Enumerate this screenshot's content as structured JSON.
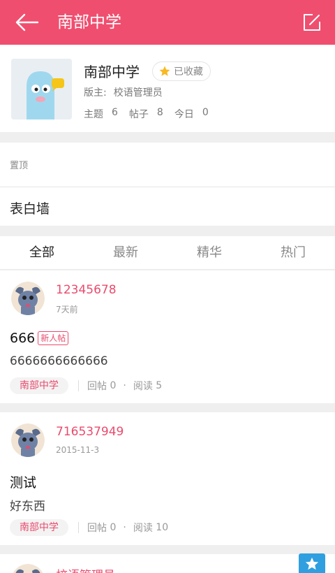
{
  "header": {
    "title": "南部中学",
    "back_icon": "arrow-left-icon",
    "edit_icon": "edit-icon"
  },
  "forum": {
    "name": "南部中学",
    "favorite_label": "已收藏",
    "moderator_label": "版主:",
    "moderator_name": "校语管理员",
    "stats": [
      {
        "label": "主题",
        "value": "6"
      },
      {
        "label": "帖子",
        "value": "8"
      },
      {
        "label": "今日",
        "value": "0"
      }
    ]
  },
  "pinned": {
    "label": "置顶",
    "items": [
      "表白墙"
    ]
  },
  "tabs": [
    {
      "label": "全部",
      "active": true
    },
    {
      "label": "最新",
      "active": false
    },
    {
      "label": "精华",
      "active": false
    },
    {
      "label": "热门",
      "active": false
    }
  ],
  "posts": [
    {
      "author": "12345678",
      "time": "7天前",
      "title": "666",
      "tag": "新人帖",
      "body": "6666666666666",
      "forum": "南部中学",
      "replies_label": "回帖",
      "replies": "0",
      "views_label": "阅读",
      "views": "5"
    },
    {
      "author": "716537949",
      "time": "2015-11-3",
      "title": "测试",
      "body": "好东西",
      "forum": "南部中学",
      "replies_label": "回帖",
      "replies": "0",
      "views_label": "阅读",
      "views": "10"
    },
    {
      "author": "校语管理员"
    }
  ],
  "colors": {
    "accent": "#f04e6f",
    "link": "#e94b6d",
    "fab": "#2f9fe0"
  }
}
